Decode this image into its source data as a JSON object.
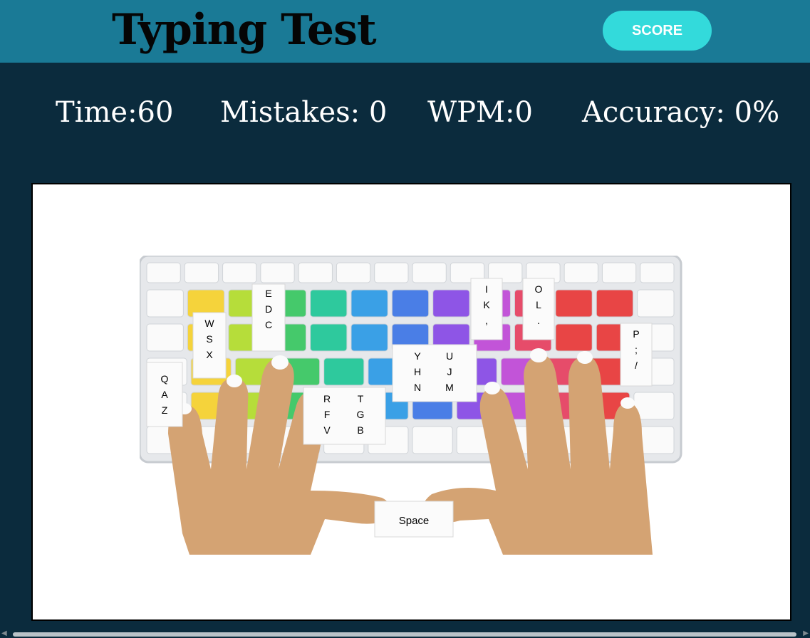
{
  "header": {
    "title": "Typing Test",
    "score_button": "SCORE",
    "background": "#1a7a96",
    "button_color": "#33dadb"
  },
  "stats": {
    "time": "Time:60",
    "mistakes": "Mistakes: 0",
    "wpm": "WPM:0",
    "accuracy": "Accuracy: 0%"
  },
  "illustration": {
    "space_label": "Space",
    "cards": {
      "qaz": [
        "Q",
        "A",
        "Z"
      ],
      "wsx": [
        "W",
        "S",
        "X"
      ],
      "edc": [
        "E",
        "D",
        "C"
      ],
      "rfv": [
        "R",
        "F",
        "V"
      ],
      "tgb": [
        "T",
        "G",
        "B"
      ],
      "yhn": [
        "Y",
        "H",
        "N"
      ],
      "ujm": [
        "U",
        "J",
        "M"
      ],
      "ik": [
        "I",
        "K",
        ","
      ],
      "ol": [
        "O",
        "L",
        "."
      ],
      "p": [
        "P",
        ";",
        "/"
      ]
    }
  },
  "colors": {
    "page_background": "#0b2b3d",
    "skin": "#d4a373"
  }
}
